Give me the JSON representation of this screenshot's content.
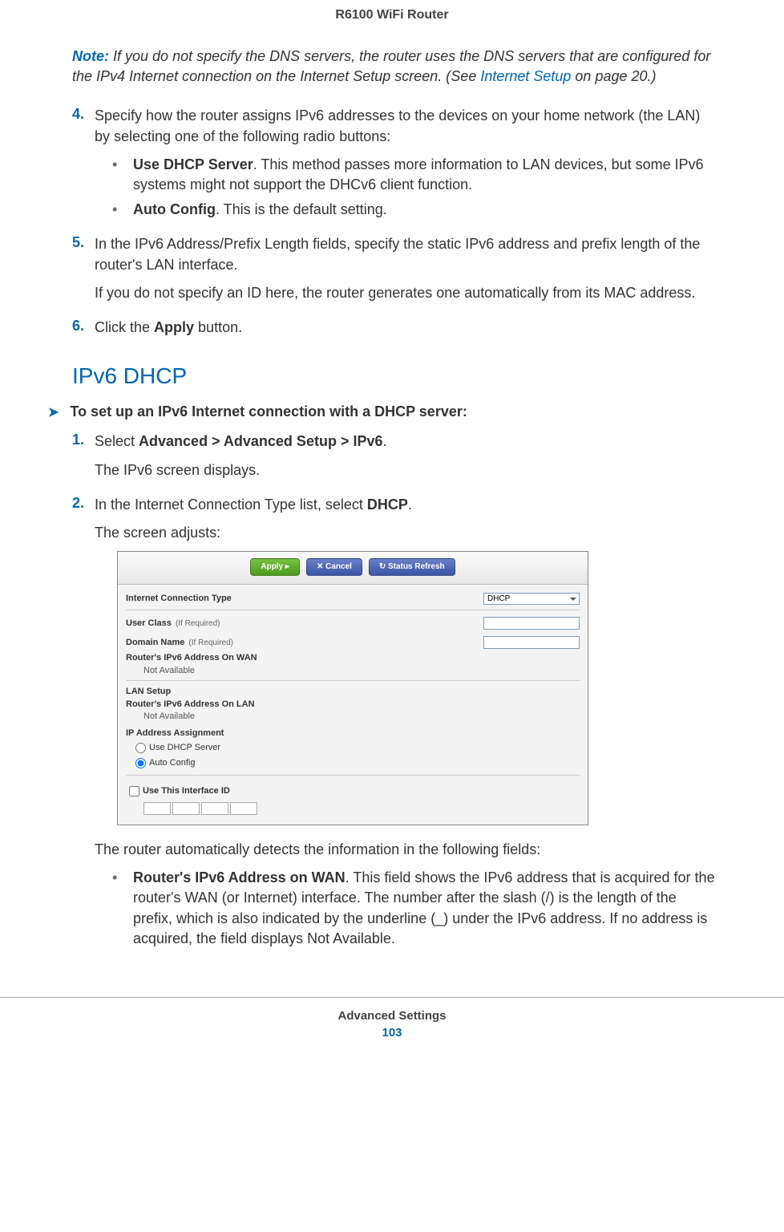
{
  "header": {
    "title": "R6100 WiFi Router"
  },
  "note": {
    "label": "Note:",
    "text_before_link": "If you do not specify the DNS servers, the router uses the DNS servers that are configured for the IPv4 Internet connection on the Internet Setup screen. (See ",
    "link": "Internet Setup",
    "text_after_link": " on page 20.)"
  },
  "steps_a": {
    "s4": {
      "num": "4.",
      "intro": "Specify how the router assigns IPv6 addresses to the devices on your home network (the LAN) by selecting one of the following radio buttons:",
      "b1_bold": "Use DHCP Server",
      "b1_rest": ". This method passes more information to LAN devices, but some IPv6 systems might not support the DHCv6 client function.",
      "b2_bold": "Auto Config",
      "b2_rest": ". This is the default setting."
    },
    "s5": {
      "num": "5.",
      "p1": "In the IPv6 Address/Prefix Length fields, specify the static IPv6 address and prefix length of the router's LAN interface.",
      "p2": "If you do not specify an ID here, the router generates one automatically from its MAC address."
    },
    "s6": {
      "num": "6.",
      "p1_a": "Click the ",
      "p1_bold": "Apply",
      "p1_b": " button."
    }
  },
  "heading": "IPv6 DHCP",
  "task": "To set up an IPv6 Internet connection with a DHCP server:",
  "steps_b": {
    "s1": {
      "num": "1.",
      "p1_a": "Select ",
      "p1_bold": "Advanced > Advanced Setup > IPv6",
      "p1_b": ".",
      "p2": "The IPv6 screen displays."
    },
    "s2": {
      "num": "2.",
      "p1_a": "In the Internet Connection Type list, select ",
      "p1_bold": "DHCP",
      "p1_b": ".",
      "p2": "The screen adjusts:"
    }
  },
  "panel": {
    "buttons": {
      "apply": "Apply ▸",
      "cancel": "✕ Cancel",
      "refresh": "↻ Status Refresh"
    },
    "conn_type_label": "Internet Connection Type",
    "conn_type_value": "DHCP",
    "user_class_label": "User Class",
    "if_required": "(If Required)",
    "domain_name_label": "Domain Name",
    "wan_label": "Router's IPv6 Address On WAN",
    "not_available": "Not Available",
    "lan_setup": "LAN Setup",
    "lan_label": "Router's IPv6 Address On LAN",
    "ip_assignment": "IP Address Assignment",
    "radio1": "Use DHCP Server",
    "radio2": "Auto Config",
    "checkbox": "Use This Interface ID"
  },
  "after_panel": {
    "intro": "The router automatically detects the information in the following fields:",
    "b1_bold": "Router's IPv6 Address on WAN",
    "b1_rest": ". This field shows the IPv6 address that is acquired for the router's WAN (or Internet) interface. The number after the slash (/) is the length of the prefix, which is also indicated by the underline (_) under the IPv6 address. If no address is acquired, the field displays Not Available."
  },
  "footer": {
    "title": "Advanced Settings",
    "page": "103"
  }
}
